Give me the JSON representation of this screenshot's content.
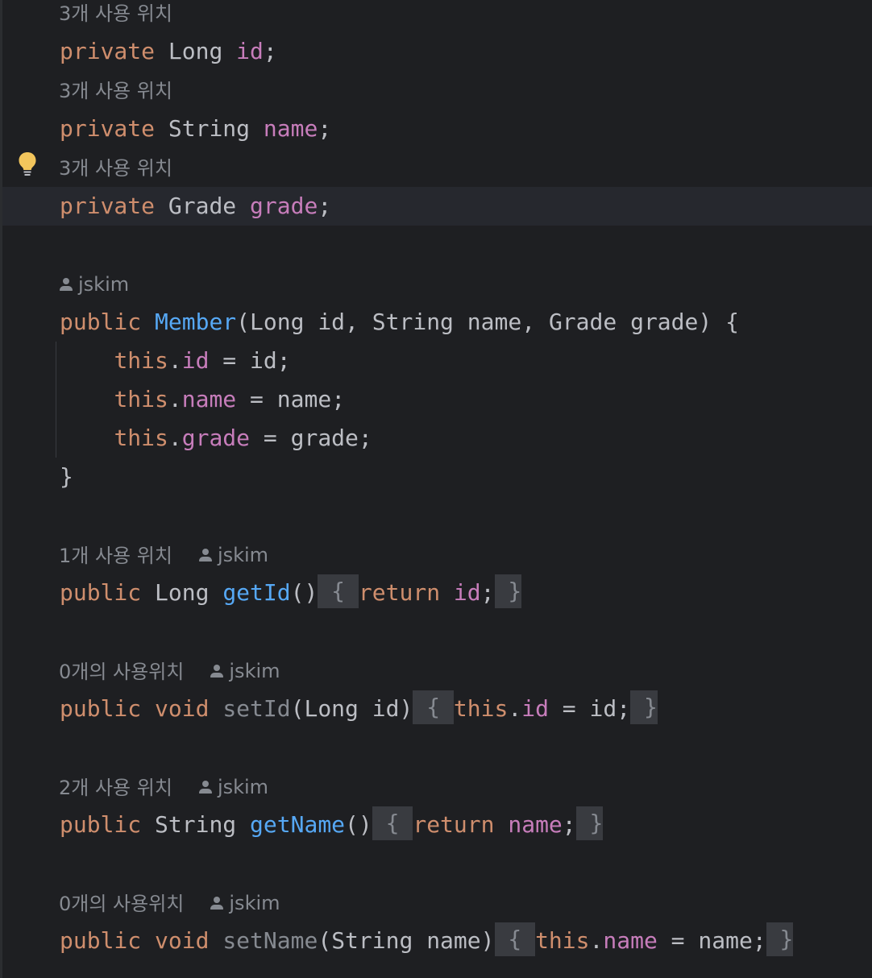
{
  "editor": {
    "hint_3_usages": "3개 사용 위치",
    "hint_1_usage": "1개 사용 위치",
    "hint_2_usages": "2개 사용 위치",
    "hint_0_usages": "0개의 사용위치",
    "author": "jskim",
    "tokens": {
      "private": "private",
      "public": "public",
      "void": "void",
      "return": "return",
      "this": "this",
      "long_type": "Long",
      "string_type": "String",
      "grade_type": "Grade",
      "id": "id",
      "name": "name",
      "grade": "grade",
      "member": "Member",
      "get_id": "getId",
      "set_id": "setId",
      "get_name": "getName",
      "set_name": "setName",
      "semicolon": ";",
      "dot": ".",
      "space": " ",
      "assign": " = ",
      "open_paren": "(",
      "close_paren": ")",
      "empty_parens": "()",
      "comma_space": ", ",
      "open_brace": "{",
      "close_brace": "}",
      "fold_open": " { ",
      "fold_close": " }",
      "indent": "    "
    }
  },
  "colors": {
    "background": "#1e1f22",
    "keyword": "#cf8e6d",
    "field": "#c77dbb",
    "method": "#56a8f5",
    "text": "#bcbec4",
    "hint": "#868a91",
    "fold_background": "#393b40",
    "current_line": "#26282e"
  },
  "icons": {
    "intention": "lightbulb-icon",
    "author": "person-icon"
  }
}
